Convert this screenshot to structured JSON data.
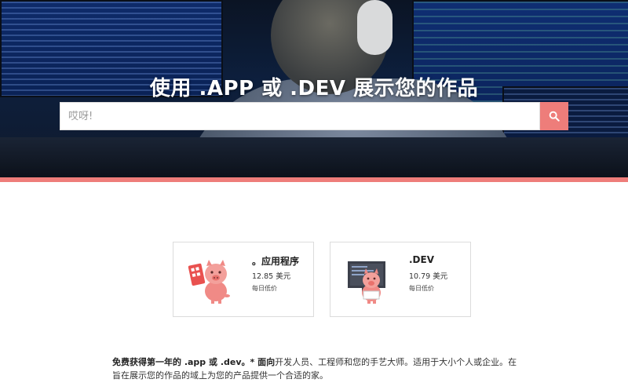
{
  "hero": {
    "title": "使用 .APP 或 .DEV 展示您的作品",
    "search": {
      "placeholder": "哎呀!",
      "value": ""
    },
    "search_button_icon": "search-icon",
    "accent_color": "#ee7d7a"
  },
  "products": [
    {
      "name": "。应用程序",
      "price": "12.85 美元",
      "note": "每日低价",
      "icon": "pig-mascot-app-icon"
    },
    {
      "name": ".DEV",
      "price": "10.79 美元",
      "note": "每日低价",
      "icon": "pig-mascot-dev-icon"
    }
  ],
  "description": {
    "bold_lead": "免费获得第一年的 .app 或 .dev。* 面向",
    "body": "开发人员、工程师和您的手艺大师。适用于大小个人或企业。在旨在展示您的作品的域上为您的产品提供一个合适的家。"
  }
}
